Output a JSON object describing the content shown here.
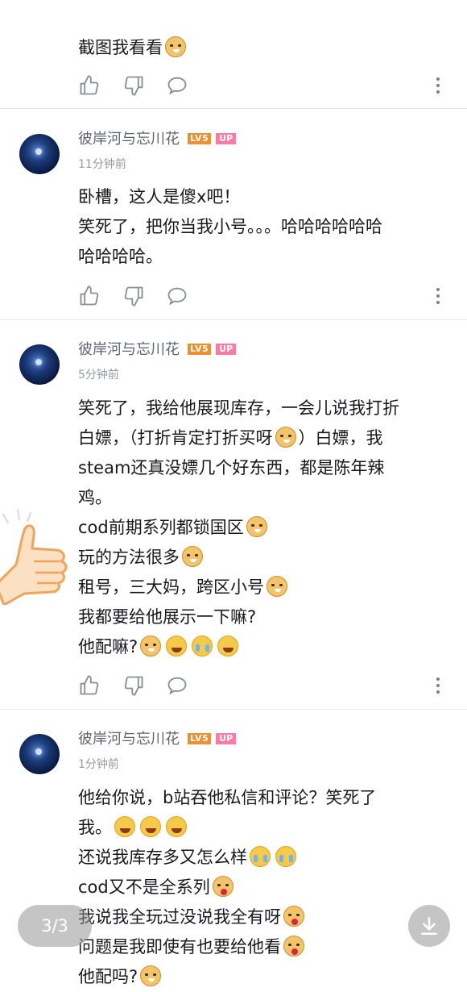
{
  "comments": [
    {
      "lines": [
        "截图我看看"
      ]
    },
    {
      "user": "彼岸河与忘川花",
      "level": "LV5",
      "up": "UP",
      "time": "11分钟前",
      "lines": [
        "卧槽，这人是傻x吧！",
        "笑死了，把你当我小号。。。哈哈哈哈哈哈",
        "哈哈哈哈。"
      ]
    },
    {
      "user": "彼岸河与忘川花",
      "level": "LV5",
      "up": "UP",
      "time": "5分钟前",
      "lines": [
        "笑死了，我给他展现库存，一会儿说我打折",
        "白嫖，（打折肯定打折买呀",
        "）白嫖，我",
        "steam还真没嫖几个好东西，都是陈年辣",
        "鸡。",
        "cod前期系列都锁国区",
        "玩的方法很多",
        "租号，三大妈，跨区小号",
        "我都要给他展示一下嘛?",
        "他配嘛?"
      ]
    },
    {
      "user": "彼岸河与忘川花",
      "level": "LV5",
      "up": "UP",
      "time": "1分钟前",
      "lines": [
        "他给你说，b站吞他私信和评论？笑死了",
        "我。",
        "还说我库存多又怎么样",
        "cod又不是全系列",
        "我说我全玩过没说我全有呀",
        "问题是我即使有也要给他看",
        "他配吗?"
      ]
    }
  ],
  "icons": {
    "like": "thumbs-up-icon",
    "dislike": "thumbs-down-icon",
    "reply": "comment-bubble-icon",
    "more": "more-vertical-icon",
    "download": "download-icon"
  },
  "pager": "3/3",
  "colors": {
    "level_badge": "#ef8f2f",
    "up_badge": "#ff7aa2",
    "username": "#5f6470",
    "time": "#9499a0"
  }
}
